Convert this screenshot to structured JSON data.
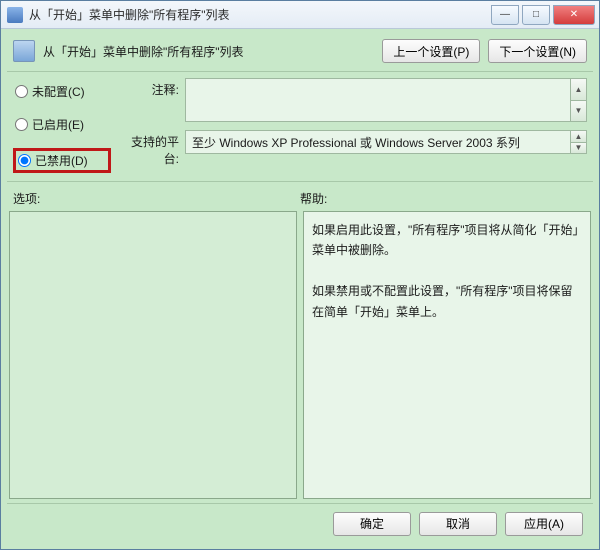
{
  "titlebar": {
    "text": "从「开始」菜单中删除\"所有程序\"列表"
  },
  "winbtns": {
    "min": "—",
    "max": "□",
    "close": "✕"
  },
  "header": {
    "title": "从「开始」菜单中删除\"所有程序\"列表",
    "prev": "上一个设置(P)",
    "next": "下一个设置(N)"
  },
  "radios": {
    "not_configured": "未配置(C)",
    "enabled": "已启用(E)",
    "disabled": "已禁用(D)"
  },
  "fields": {
    "comment_label": "注释:",
    "platform_label": "支持的平台:",
    "platform_value": "至少 Windows XP Professional 或 Windows Server 2003 系列"
  },
  "section": {
    "options": "选项:",
    "help": "帮助:"
  },
  "help": {
    "p1": "如果启用此设置，\"所有程序\"项目将从简化「开始」菜单中被删除。",
    "p2": "如果禁用或不配置此设置，\"所有程序\"项目将保留在简单「开始」菜单上。"
  },
  "footer": {
    "ok": "确定",
    "cancel": "取消",
    "apply": "应用(A)"
  },
  "glyph": {
    "up": "▲",
    "down": "▼"
  }
}
